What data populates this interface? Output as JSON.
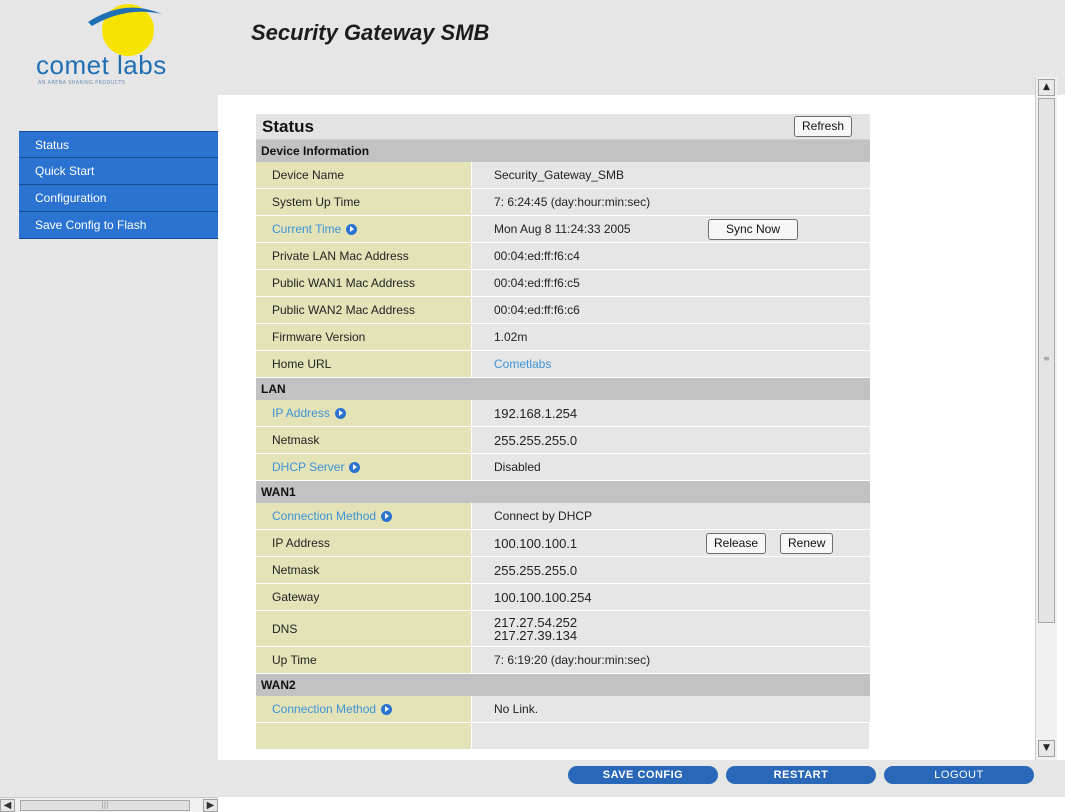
{
  "header": {
    "logo_text": "comet labs",
    "logo_sub": "AN ARENA SHARING PRODUCTS",
    "app_title": "Security Gateway SMB"
  },
  "sidebar": {
    "items": [
      {
        "label": "Status"
      },
      {
        "label": "Quick Start"
      },
      {
        "label": "Configuration"
      },
      {
        "label": "Save Config to Flash"
      }
    ]
  },
  "panel": {
    "title": "Status",
    "refresh_label": "Refresh"
  },
  "device": {
    "section": "Device Information",
    "device_name": {
      "label": "Device Name",
      "value": "Security_Gateway_SMB"
    },
    "uptime": {
      "label": "System Up Time",
      "value": "7: 6:24:45 (day:hour:min:sec)"
    },
    "current_time": {
      "label": "Current Time",
      "value": "Mon Aug 8 11:24:33 2005",
      "button": "Sync Now"
    },
    "lan_mac": {
      "label": "Private LAN Mac Address",
      "value": "00:04:ed:ff:f6:c4"
    },
    "wan1_mac": {
      "label": "Public WAN1 Mac Address",
      "value": "00:04:ed:ff:f6:c5"
    },
    "wan2_mac": {
      "label": "Public WAN2 Mac Address",
      "value": "00:04:ed:ff:f6:c6"
    },
    "firmware": {
      "label": "Firmware Version",
      "value": "1.02m"
    },
    "home_url": {
      "label": "Home URL",
      "value": "Cometlabs"
    }
  },
  "lan": {
    "section": "LAN",
    "ip": {
      "label": "IP Address",
      "value": "192.168.1.254"
    },
    "netmask": {
      "label": "Netmask",
      "value": "255.255.255.0"
    },
    "dhcp": {
      "label": "DHCP Server",
      "value": "Disabled"
    }
  },
  "wan1": {
    "section": "WAN1",
    "method": {
      "label": "Connection Method",
      "value": "Connect by DHCP"
    },
    "ip": {
      "label": "IP Address",
      "value": "100.100.100.1",
      "release": "Release",
      "renew": "Renew"
    },
    "netmask": {
      "label": "Netmask",
      "value": "255.255.255.0"
    },
    "gateway": {
      "label": "Gateway",
      "value": "100.100.100.254"
    },
    "dns": {
      "label": "DNS",
      "value1": "217.27.54.252",
      "value2": "217.27.39.134"
    },
    "uptime": {
      "label": "Up Time",
      "value": "7: 6:19:20 (day:hour:min:sec)"
    }
  },
  "wan2": {
    "section": "WAN2",
    "method": {
      "label": "Connection Method",
      "value": "No Link."
    }
  },
  "footer": {
    "save": "SAVE CONFIG",
    "restart": "RESTART",
    "logout": "LOGOUT"
  },
  "colors": {
    "nav_blue": "#2b73d1",
    "label_bg": "#e4e3b8",
    "section_bg": "#c2c2c2",
    "link": "#3c93d8"
  }
}
